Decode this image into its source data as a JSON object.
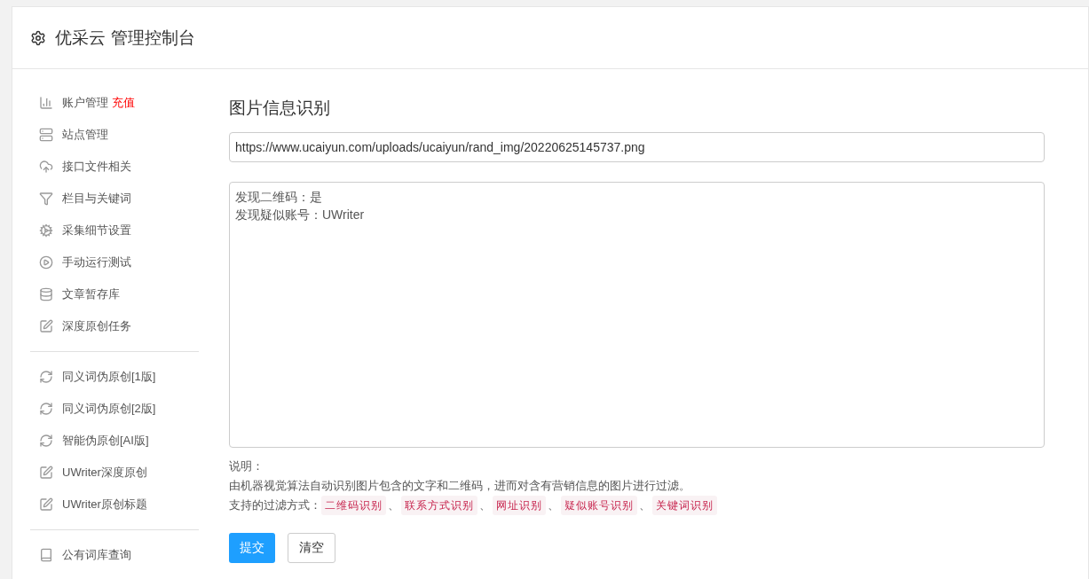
{
  "header": {
    "title": "优采云 管理控制台"
  },
  "sidebar": {
    "groups": [
      [
        {
          "label": "账户管理",
          "badge": "充值"
        },
        {
          "label": "站点管理"
        },
        {
          "label": "接口文件相关"
        },
        {
          "label": "栏目与关键词"
        },
        {
          "label": "采集细节设置"
        },
        {
          "label": "手动运行测试"
        },
        {
          "label": "文章暂存库"
        },
        {
          "label": "深度原创任务"
        }
      ],
      [
        {
          "label": "同义词伪原创[1版]"
        },
        {
          "label": "同义词伪原创[2版]"
        },
        {
          "label": "智能伪原创[AI版]"
        },
        {
          "label": "UWriter深度原创"
        },
        {
          "label": "UWriter原创标题"
        }
      ],
      [
        {
          "label": "公有词库查询"
        }
      ]
    ]
  },
  "main": {
    "title": "图片信息识别",
    "url_field": {
      "value": "https://www.ucaiyun.com/uploads/ucaiyun/rand_img/20220625145737.png"
    },
    "result_box": {
      "lines": [
        "发现二维码：是",
        "发现疑似账号：UWriter"
      ]
    },
    "notes_label": "说明：",
    "description": "由机器视觉算法自动识别图片包含的文字和二维码，进而对含有营销信息的图片进行过滤。",
    "filters_label": "支持的过滤方式：",
    "filters": [
      "二维码识别",
      "联系方式识别",
      "网址识别",
      "疑似账号识别",
      "关键词识别"
    ],
    "separator": "、",
    "buttons": [
      {
        "label": "提交",
        "kind": "primary"
      },
      {
        "label": "清空",
        "kind": "default"
      }
    ]
  }
}
